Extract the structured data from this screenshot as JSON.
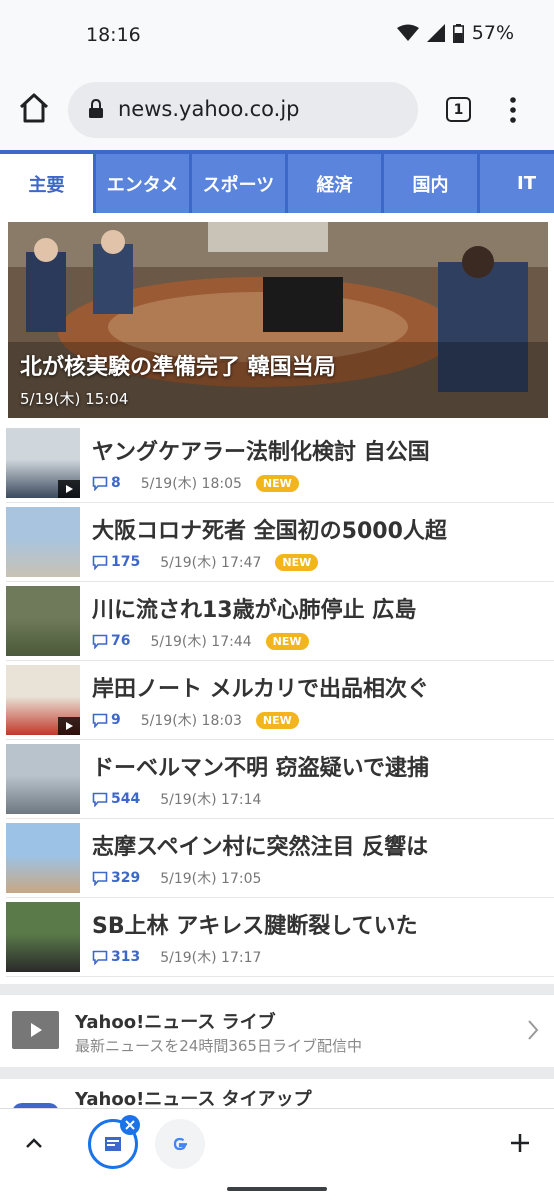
{
  "status_bar": {
    "time": "18:16",
    "battery": "57%"
  },
  "browser": {
    "url": "news.yahoo.co.jp",
    "tab_count": "1"
  },
  "categories": [
    {
      "label": "主要",
      "active": true
    },
    {
      "label": "エンタメ",
      "active": false
    },
    {
      "label": "スポーツ",
      "active": false
    },
    {
      "label": "経済",
      "active": false
    },
    {
      "label": "国内",
      "active": false
    },
    {
      "label": "IT",
      "active": false
    }
  ],
  "hero": {
    "title": "北が核実験の準備完了 韓国当局",
    "date": "5/19(木) 15:04"
  },
  "news": [
    {
      "title": "ヤングケアラー法制化検討 自公国",
      "comments": "8",
      "date": "5/19(木) 18:05",
      "badge": "NEW",
      "video": true
    },
    {
      "title": "大阪コロナ死者 全国初の5000人超",
      "comments": "175",
      "date": "5/19(木) 17:47",
      "badge": "NEW",
      "video": false
    },
    {
      "title": "川に流され13歳が心肺停止 広島",
      "comments": "76",
      "date": "5/19(木) 17:44",
      "badge": "NEW",
      "video": false
    },
    {
      "title": "岸田ノート メルカリで出品相次ぐ",
      "comments": "9",
      "date": "5/19(木) 18:03",
      "badge": "NEW",
      "video": true
    },
    {
      "title": "ドーベルマン不明 窃盗疑いで逮捕",
      "comments": "544",
      "date": "5/19(木) 17:14",
      "badge": "",
      "video": false
    },
    {
      "title": "志摩スペイン村に突然注目 反響は",
      "comments": "329",
      "date": "5/19(木) 17:05",
      "badge": "",
      "video": false
    },
    {
      "title": "SB上林 アキレス腱断裂していた",
      "comments": "313",
      "date": "5/19(木) 17:17",
      "badge": "",
      "video": false
    }
  ],
  "live": {
    "title": "Yahoo!ニュース ライブ",
    "subtitle": "最新ニュースを24時間365日ライブ配信中"
  },
  "tieup": {
    "title": "Yahoo!ニュース タイアップ"
  },
  "icons": {
    "home": "home-icon",
    "lock": "lock-icon",
    "menu": "more-vert-icon",
    "comment": "comment-icon",
    "play": "play-icon",
    "chevron": "chevron-right-icon",
    "up": "chevron-up-icon",
    "plus": "plus-icon",
    "google": "google-icon",
    "close": "close-icon"
  },
  "colors": {
    "yahoo_blue": "#3d68c9",
    "tab_blue": "#5b84dd",
    "new_badge": "#f2b51b",
    "chrome_blue": "#1a73e8"
  }
}
